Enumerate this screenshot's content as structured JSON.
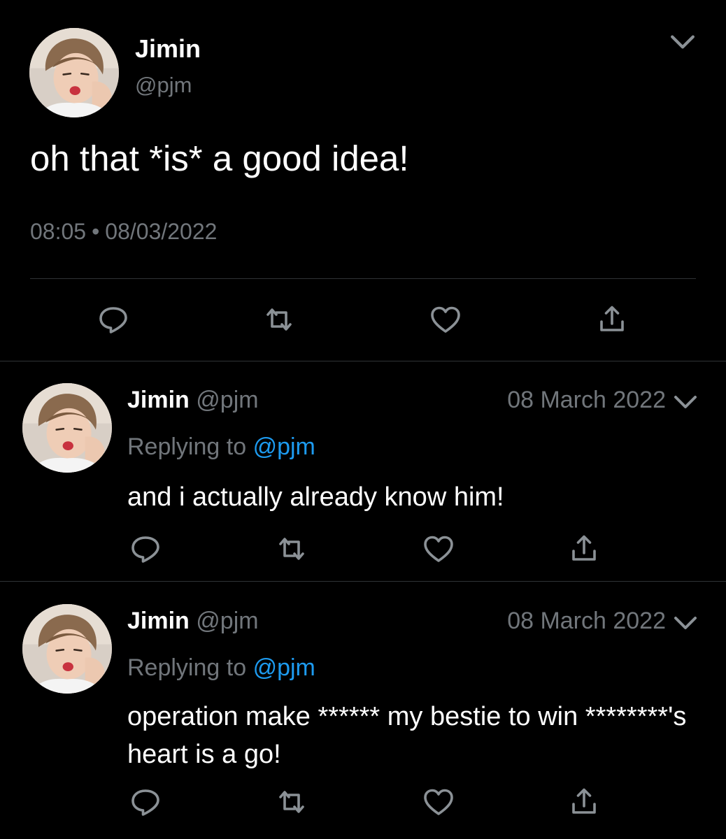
{
  "main_tweet": {
    "name": "Jimin",
    "handle": "@pjm",
    "text": "oh that *is* a good idea!",
    "time": "08:05",
    "separator": "•",
    "date": "08/03/2022",
    "actions": {
      "reply_icon": "reply-icon",
      "retweet_icon": "retweet-icon",
      "like_icon": "heart-icon",
      "share_icon": "share-icon"
    }
  },
  "replies": [
    {
      "name": "Jimin",
      "handle": "@pjm",
      "date": "08 March 2022",
      "replying_prefix": "Replying to",
      "replying_to": "@pjm",
      "text": "and i actually already know him!"
    },
    {
      "name": "Jimin",
      "handle": "@pjm",
      "date": "08 March 2022",
      "replying_prefix": "Replying to",
      "replying_to": "@pjm",
      "text": "operation make ****** my bestie to win ********'s heart is a go!"
    }
  ],
  "colors": {
    "background": "#000000",
    "primary_text": "#ffffff",
    "secondary_text": "#71767b",
    "link": "#1d9bf0",
    "divider": "#2f3336",
    "icon": "#8b9196"
  }
}
